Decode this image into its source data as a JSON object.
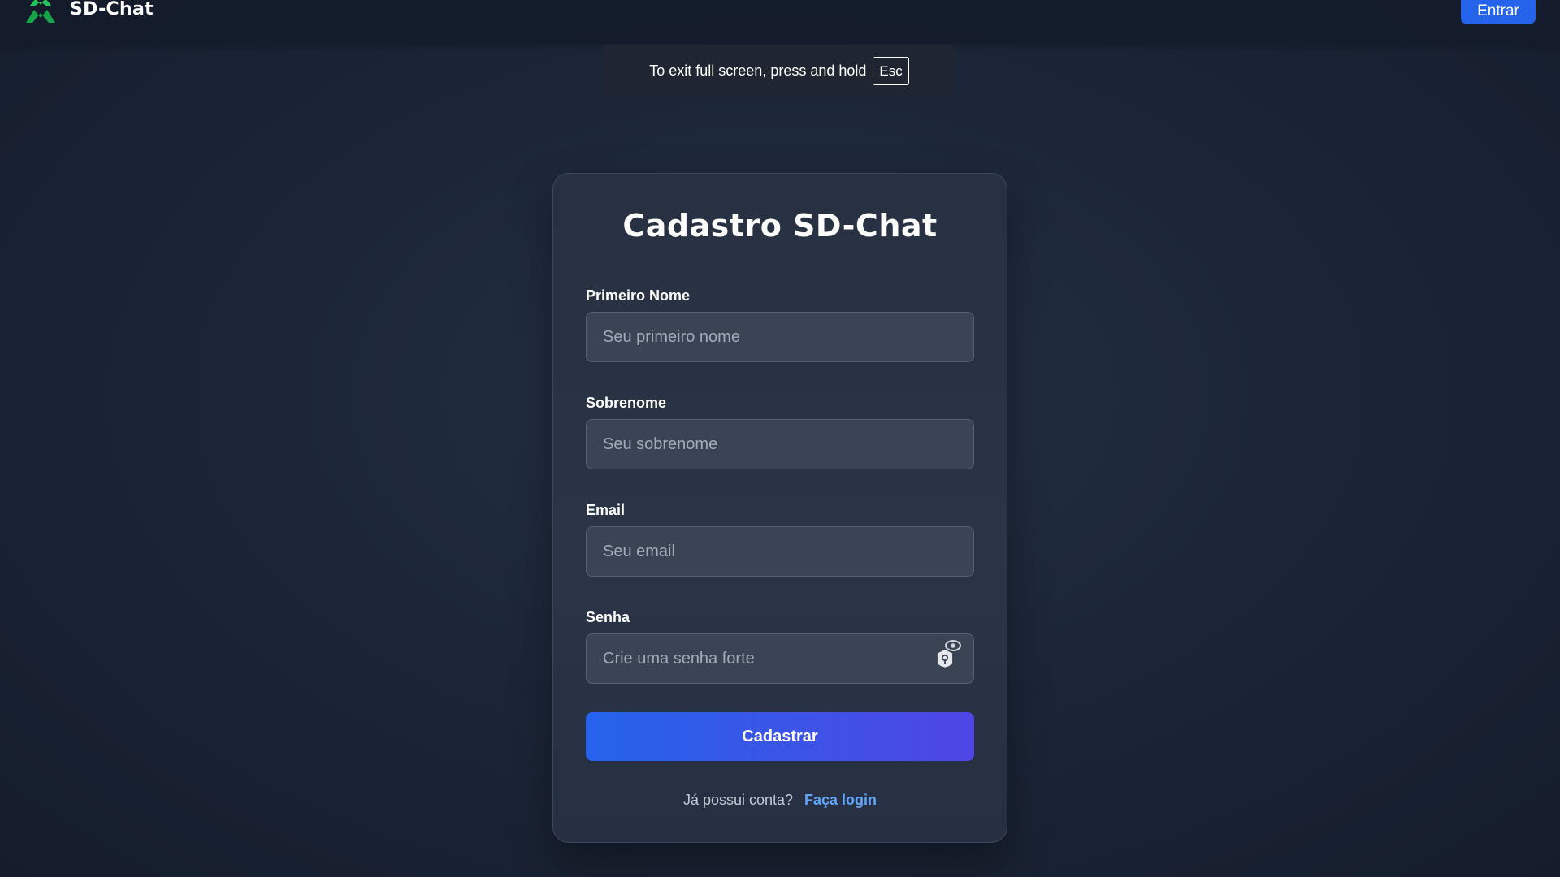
{
  "header": {
    "brand_name": "SD-Chat",
    "login_label": "Entrar"
  },
  "fullscreen_notice": {
    "text": "To exit full screen, press and hold",
    "key": "Esc"
  },
  "form": {
    "title": "Cadastro SD-Chat",
    "fields": [
      {
        "label": "Primeiro Nome",
        "placeholder": "Seu primeiro nome",
        "value": ""
      },
      {
        "label": "Sobrenome",
        "placeholder": "Seu sobrenome",
        "value": ""
      },
      {
        "label": "Email",
        "placeholder": "Seu email",
        "value": ""
      },
      {
        "label": "Senha",
        "placeholder": "Crie uma senha forte",
        "value": ""
      }
    ],
    "submit_label": "Cadastrar",
    "footer_text": "Já possui conta?",
    "footer_link": "Faça login"
  },
  "icons": {
    "brand": "sd-chat-logo-icon",
    "password": "password-toggle-icon"
  },
  "colors": {
    "accent": "#2563eb",
    "accent_end": "#4f46e5",
    "link": "#60a5fa",
    "logo_green": "#16a34a"
  }
}
